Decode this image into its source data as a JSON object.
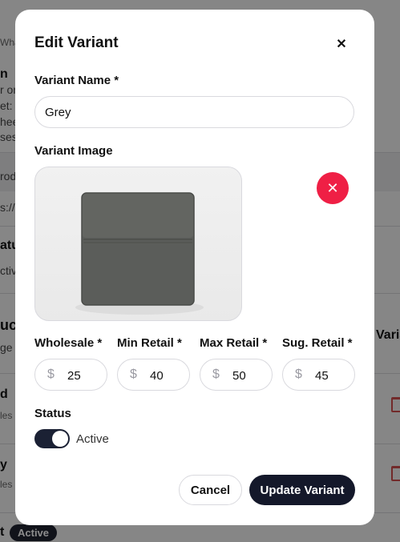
{
  "background": {
    "fragments": {
      "what": "What",
      "n": "n",
      "om": "r om",
      "et": "et:",
      "hee": "hee",
      "ses": "ses",
      "rod": "rod",
      "s": "s://",
      "atu": "atu",
      "ctive": "ctive",
      "uct": "uct",
      "ge": "ge c",
      "d": "d",
      "les1": "les",
      "y": "y",
      "les2": "les",
      "t": "t",
      "varia": "Varia"
    },
    "badge_active": "Active"
  },
  "modal": {
    "title": "Edit Variant",
    "close_icon": "close-icon",
    "variant_name_label": "Variant Name *",
    "variant_name_value": "Grey",
    "variant_image_label": "Variant Image",
    "remove_image_icon": "x-icon",
    "remove_color": "#ef1f45",
    "prices": [
      {
        "label": "Wholesale *",
        "currency": "$",
        "value": "25"
      },
      {
        "label": "Min Retail *",
        "currency": "$",
        "value": "40"
      },
      {
        "label": "Max Retail *",
        "currency": "$",
        "value": "50"
      },
      {
        "label": "Sug. Retail *",
        "currency": "$",
        "value": "45"
      }
    ],
    "status_label": "Status",
    "status_value": "Active",
    "status_on": true,
    "cancel_label": "Cancel",
    "update_label": "Update Variant",
    "primary_color": "#14182a"
  }
}
